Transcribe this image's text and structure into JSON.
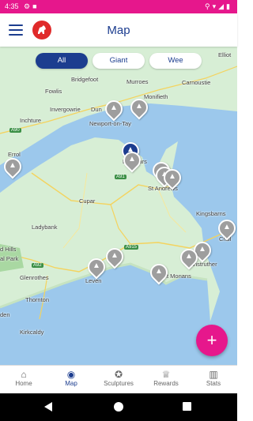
{
  "status_bar": {
    "time": "4:35",
    "left_icons": [
      "settings-icon",
      "app-badge-icon"
    ],
    "right_icons": [
      "location-icon",
      "wifi-icon",
      "signal-icon",
      "battery-icon"
    ]
  },
  "app_bar": {
    "title": "Map",
    "menu_icon": "hamburger-menu-icon",
    "logo_icon": "dog-logo-icon"
  },
  "filters": [
    {
      "label": "All",
      "active": true
    },
    {
      "label": "Giant",
      "active": false
    },
    {
      "label": "Wee",
      "active": false
    }
  ],
  "map_labels": {
    "elliot": "Elliot",
    "bridgefoot": "Bridgefoot",
    "murroes": "Murroes",
    "carnoustie": "Carnoustie",
    "fowlis": "Fowlis",
    "invergowrie": "Invergowrie",
    "dundee": "Dun",
    "monifieth": "Monifieth",
    "inchture": "Inchture",
    "newport": "Newport-on-Tay",
    "errol": "Errol",
    "leuchars": "Leuchars",
    "st_andrews": "St Andrews",
    "cupar": "Cupar",
    "kingsbarns": "Kingsbarns",
    "ladybank": "Ladybank",
    "crail": "Crail",
    "hills": "d Hills",
    "park": "al Park",
    "anstruther": "Anstruther",
    "glenrothes": "Glenrothes",
    "leven": "Leven",
    "st_monans": "St Monans",
    "thornton": "Thornton",
    "den": "den",
    "kirkcaldy": "Kirkcaldy"
  },
  "road_labels": {
    "a90": "A90",
    "a91": "A91",
    "a915": "A915",
    "a92": "A92"
  },
  "fab": {
    "label": "+"
  },
  "bottom_nav": [
    {
      "label": "Home",
      "icon": "home-icon",
      "active": false
    },
    {
      "label": "Map",
      "icon": "map-pin-icon",
      "active": true
    },
    {
      "label": "Sculptures",
      "icon": "sculpture-icon",
      "active": false
    },
    {
      "label": "Rewards",
      "icon": "trophy-icon",
      "active": false
    },
    {
      "label": "Stats",
      "icon": "bar-chart-icon",
      "active": false
    }
  ],
  "colors": {
    "accent": "#e6178c",
    "brand": "#1c3d8f",
    "water": "#9cc8ec",
    "land": "#d7eed5",
    "pin": "#9e9e9e"
  }
}
